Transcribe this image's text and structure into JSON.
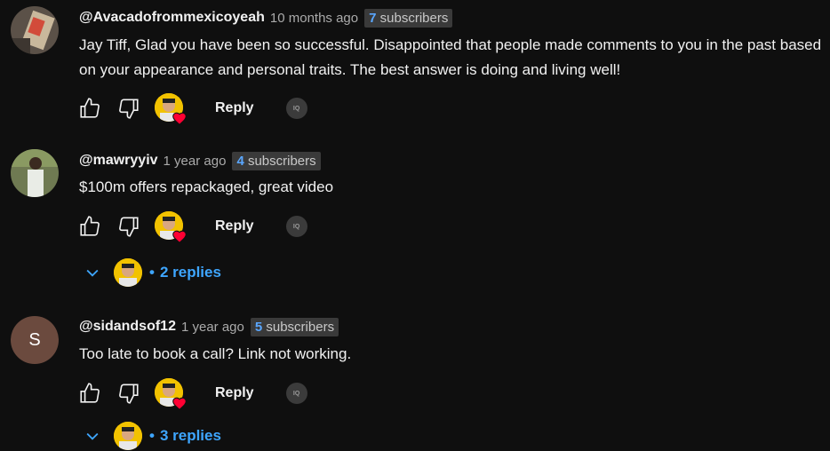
{
  "comments": [
    {
      "handle": "@Avacadofrommexicoyeah",
      "time": "10 months ago",
      "subs_num": "7",
      "subs_label": "subscribers",
      "text": "Jay Tiff, Glad you have been so successful. Disappointed that people made comments to you in the past based on your appearance and personal traits. The best answer is doing and living well!",
      "reply_label": "Reply",
      "iq_label": "IQ"
    },
    {
      "handle": "@mawryyiv",
      "time": "1 year ago",
      "subs_num": "4",
      "subs_label": "subscribers",
      "text": "$100m offers repackaged, great video",
      "reply_label": "Reply",
      "iq_label": "IQ",
      "replies_label": "2 replies"
    },
    {
      "handle": "@sidandsof12",
      "time": "1 year ago",
      "subs_num": "5",
      "subs_label": "subscribers",
      "avatar_letter": "S",
      "text": "Too late to book a call? Link not working.",
      "reply_label": "Reply",
      "iq_label": "IQ",
      "replies_label": "3 replies"
    }
  ],
  "colors": {
    "background": "#0f0f0f",
    "link": "#3ea6ff",
    "heart": "#ff0033",
    "creator_avatar": "#f2c200"
  }
}
